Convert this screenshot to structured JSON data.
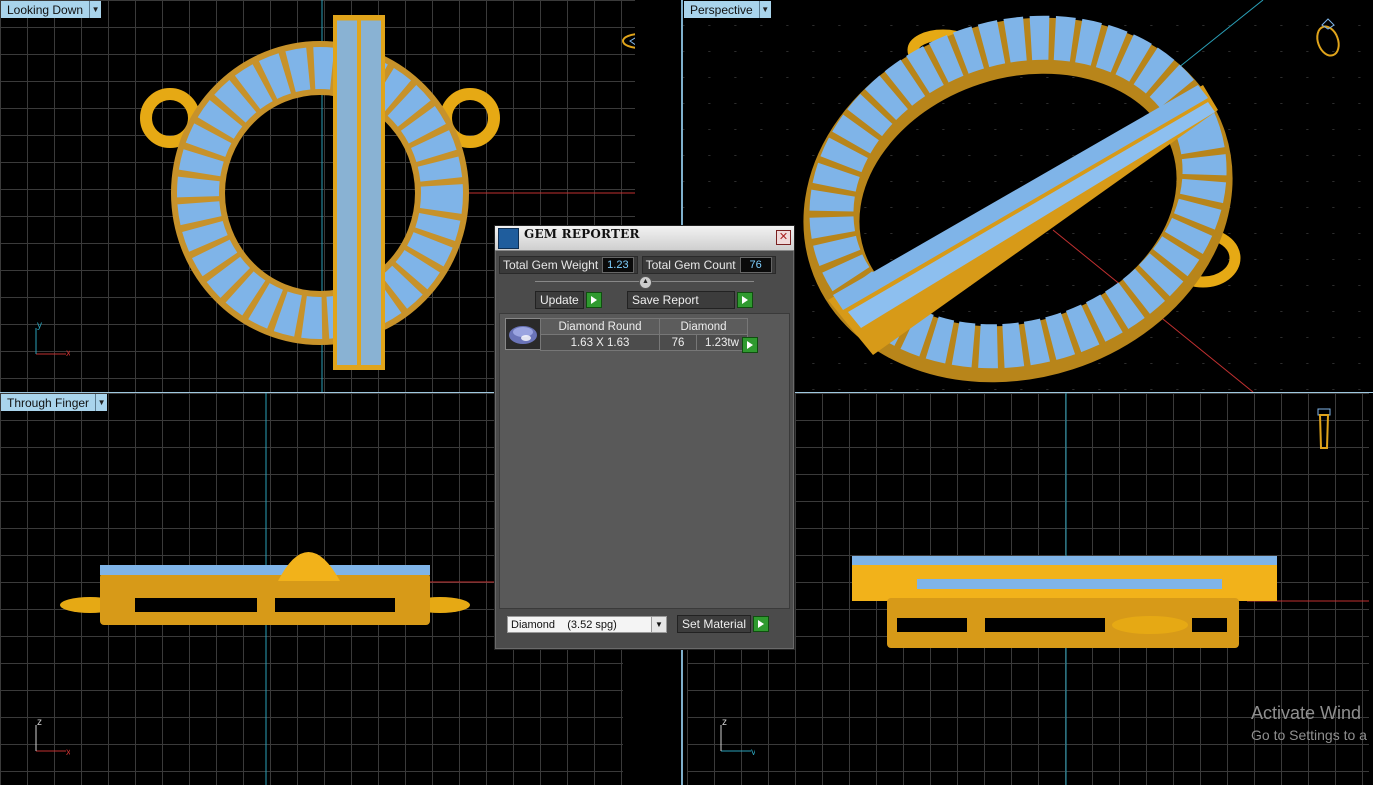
{
  "viewports": {
    "top_left": {
      "label": "Looking Down",
      "axis_x": "x",
      "axis_y": "y"
    },
    "top_right": {
      "label": "Perspective"
    },
    "bottom_left": {
      "label": "Through Finger",
      "axis_h": "x",
      "axis_v": "z"
    },
    "bottom_right": {
      "axis_h": "y",
      "axis_v": "z"
    }
  },
  "dialog": {
    "title": "GEM REPORTER",
    "close_glyph": "✕",
    "total_weight_label": "Total Gem Weight",
    "total_weight_value": "1.23",
    "total_count_label": "Total Gem Count",
    "total_count_value": "76",
    "update_label": "Update",
    "save_report_label": "Save Report",
    "table": {
      "col1_header": "Diamond Round",
      "col2_header": "Diamond",
      "size": "1.63 X 1.63",
      "count": "76",
      "weight": "1.23tw"
    },
    "material_select": "Diamond    (3.52 spg)",
    "set_material_label": "Set Material"
  },
  "watermark": {
    "line1": "Activate Wind",
    "line2": "Go to Settings to a"
  },
  "colors": {
    "gold": "#f2b21a",
    "gem": "#7fb4e8",
    "label_bg": "#a9d4ec",
    "grid": "#3a3a3a"
  }
}
